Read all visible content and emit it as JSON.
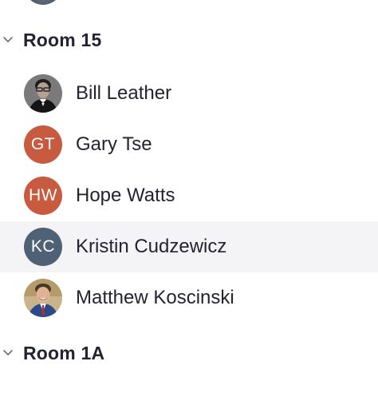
{
  "rooms": [
    {
      "name": "Room 15",
      "expanded": true,
      "participants": [
        {
          "name": "Bill Leather",
          "avatar": "photo",
          "icon": "person-photo-icon"
        },
        {
          "name": "Gary Tse",
          "avatar": "initials",
          "initials": "GT",
          "color": "#c75a3f"
        },
        {
          "name": "Hope Watts",
          "avatar": "initials",
          "initials": "HW",
          "color": "#c75a3f"
        },
        {
          "name": "Kristin Cudzewicz",
          "avatar": "initials",
          "initials": "KC",
          "color": "#4e6175",
          "highlighted": true
        },
        {
          "name": "Matthew Koscinski",
          "avatar": "photo",
          "icon": "person-photo-icon"
        }
      ]
    },
    {
      "name": "Room 1A",
      "expanded": true,
      "participants": []
    }
  ],
  "colors": {
    "text": "#232333",
    "row_highlight": "#f4f4f6",
    "chevron": "#6e6e7a"
  }
}
